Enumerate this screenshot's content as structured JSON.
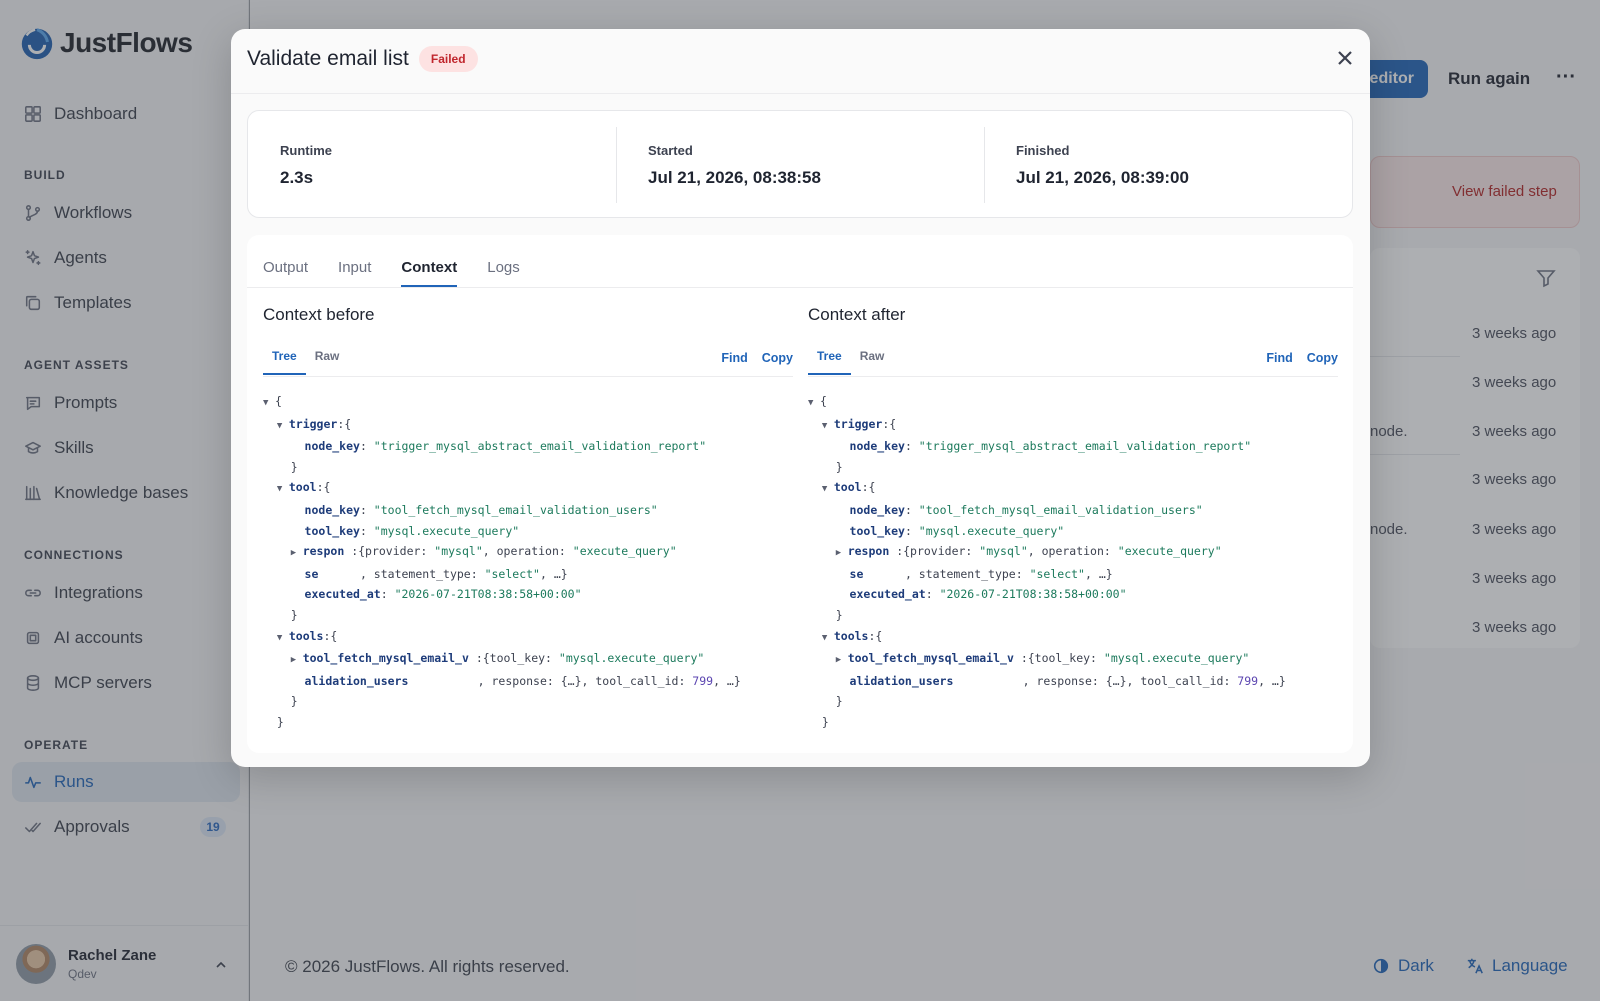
{
  "app": {
    "brand": "JustFlows"
  },
  "sidebar": {
    "sections": {
      "build": "BUILD",
      "agent_assets": "AGENT ASSETS",
      "connections": "CONNECTIONS",
      "operate": "OPERATE"
    },
    "items": {
      "dashboard": "Dashboard",
      "workflows": "Workflows",
      "agents": "Agents",
      "templates": "Templates",
      "prompts": "Prompts",
      "skills": "Skills",
      "knowledge": "Knowledge bases",
      "integrations": "Integrations",
      "ai_accounts": "AI accounts",
      "mcp": "MCP servers",
      "runs": "Runs",
      "approvals": "Approvals"
    },
    "approvals_count": "19",
    "user": {
      "name": "Rachel Zane",
      "org": "Qdev"
    }
  },
  "background": {
    "editor_label": "editor",
    "run_again": "Run again",
    "more": "···",
    "view_failed": "View failed step",
    "rows": [
      "3 weeks ago",
      "3 weeks ago",
      "3 weeks ago",
      "3 weeks ago",
      "3 weeks ago",
      "3 weeks ago",
      "3 weeks ago"
    ],
    "row_notes": [
      "node.",
      "node."
    ],
    "footer_copy": "© 2026 JustFlows. All rights reserved.",
    "footer_dark": "Dark",
    "footer_lang": "Language"
  },
  "modal": {
    "title": "Validate email list",
    "status": "Failed",
    "stats": {
      "runtime_label": "Runtime",
      "runtime": "2.3s",
      "started_label": "Started",
      "started": "Jul 21, 2026, 08:38:58",
      "finished_label": "Finished",
      "finished": "Jul 21, 2026, 08:39:00"
    },
    "tabs": [
      "Output",
      "Input",
      "Context",
      "Logs"
    ],
    "active_tab": "Context",
    "before_title": "Context before",
    "after_title": "Context after",
    "view_tabs": [
      "Tree",
      "Raw"
    ],
    "find": "Find",
    "copy": "Copy",
    "tree": {
      "trigger_key": "trigger",
      "node_key_label": "node_key",
      "trigger_node_key": "\"trigger_mysql_abstract_email_validation_report\"",
      "tool_key_label": "tool",
      "tool_node_key": "\"tool_fetch_mysql_email_validation_users\"",
      "tool_key_field": "tool_key",
      "tool_key_value": "\"mysql.execute_query\"",
      "respon_a": "respon",
      "respon_b": "se",
      "respon_summary_1": ":{provider: ",
      "provider_value": "\"mysql\"",
      "respon_summary_2": ", operation: ",
      "operation_value": "\"execute_query\"",
      "respon_summary_3": ", statement_type: ",
      "statement_value": "\"select\"",
      "respon_summary_4": ", …}",
      "executed_at_label": "executed_at",
      "executed_at_value": "\"2026-07-21T08:38:58+00:00\"",
      "tools_label": "tools",
      "tools_item_a": "tool_fetch_mysql_email_v",
      "tools_item_b": "alidation_users",
      "tools_summary_1": ":{tool_key: ",
      "tools_summary_2": ", response: {…}, tool_call_id: ",
      "tool_call_id": "799",
      "tools_summary_3": ", …}"
    }
  }
}
